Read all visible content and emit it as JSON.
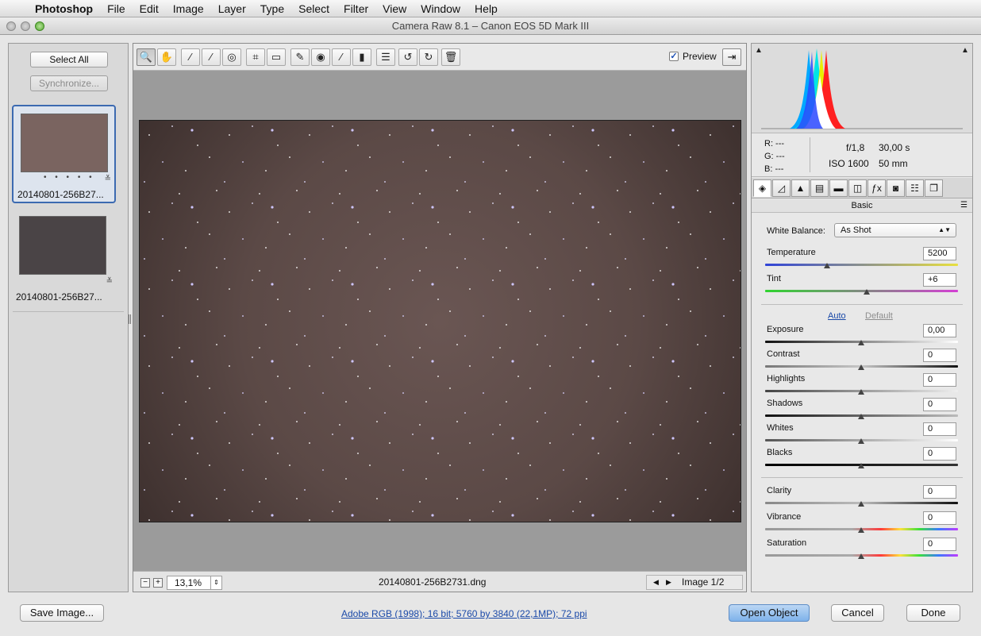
{
  "menubar": {
    "app": "Photoshop",
    "items": [
      "File",
      "Edit",
      "Image",
      "Layer",
      "Type",
      "Select",
      "Filter",
      "View",
      "Window",
      "Help"
    ]
  },
  "window": {
    "title": "Camera Raw 8.1  –  Canon EOS 5D Mark III"
  },
  "filmstrip": {
    "select_all": "Select All",
    "synchronize": "Synchronize...",
    "thumbnails": [
      {
        "name": "20140801-256B27...",
        "rating_dots": "• • • • •",
        "selected": true
      },
      {
        "name": "20140801-256B27...",
        "selected": false
      }
    ]
  },
  "toolbar": {
    "tools": [
      {
        "name": "zoom-tool",
        "glyph": "🔍"
      },
      {
        "name": "hand-tool",
        "glyph": "✋"
      },
      {
        "name": "white-balance-tool",
        "glyph": "⁄"
      },
      {
        "name": "color-sampler-tool",
        "glyph": "⁄"
      },
      {
        "name": "targeted-adjustment-tool",
        "glyph": "◎"
      },
      {
        "name": "crop-tool",
        "glyph": "⌗"
      },
      {
        "name": "straighten-tool",
        "glyph": "▭"
      },
      {
        "name": "spot-removal-tool",
        "glyph": "✎"
      },
      {
        "name": "red-eye-tool",
        "glyph": "◉"
      },
      {
        "name": "adjustment-brush-tool",
        "glyph": "∕"
      },
      {
        "name": "graduated-filter-tool",
        "glyph": "▮"
      },
      {
        "name": "radial-filter-tool",
        "glyph": "☰"
      },
      {
        "name": "rotate-left-tool",
        "glyph": "↺"
      },
      {
        "name": "rotate-right-tool",
        "glyph": "↻"
      },
      {
        "name": "trash-tool",
        "glyph": "🗑"
      }
    ],
    "preview_label": "Preview"
  },
  "canvas": {
    "zoom": "13,1%",
    "filename": "20140801-256B2731.dng",
    "image_counter": "Image 1/2"
  },
  "histogram": {
    "readout": {
      "r": "R:   ---",
      "g": "G:   ---",
      "b": "B:   ---"
    },
    "aperture": "f/1,8",
    "shutter": "30,00 s",
    "iso": "ISO 1600",
    "focal": "50 mm"
  },
  "panel": {
    "section_title": "Basic",
    "white_balance_label": "White Balance:",
    "white_balance_value": "As Shot",
    "auto": "Auto",
    "default": "Default",
    "sliders": {
      "temperature": {
        "label": "Temperature",
        "value": "5200"
      },
      "tint": {
        "label": "Tint",
        "value": "+6"
      },
      "exposure": {
        "label": "Exposure",
        "value": "0,00"
      },
      "contrast": {
        "label": "Contrast",
        "value": "0"
      },
      "highlights": {
        "label": "Highlights",
        "value": "0"
      },
      "shadows": {
        "label": "Shadows",
        "value": "0"
      },
      "whites": {
        "label": "Whites",
        "value": "0"
      },
      "blacks": {
        "label": "Blacks",
        "value": "0"
      },
      "clarity": {
        "label": "Clarity",
        "value": "0"
      },
      "vibrance": {
        "label": "Vibrance",
        "value": "0"
      },
      "saturation": {
        "label": "Saturation",
        "value": "0"
      }
    }
  },
  "footer": {
    "save_image": "Save Image...",
    "workflow_link": "Adobe RGB (1998); 16 bit; 5760 by 3840 (22,1MP); 72 ppi",
    "open_object": "Open Object",
    "cancel": "Cancel",
    "done": "Done"
  },
  "colors": {
    "accent": "#3c6ab1",
    "primary_button": "#7eb2ea",
    "link": "#1a49a8",
    "sky": "#5e4b48"
  }
}
